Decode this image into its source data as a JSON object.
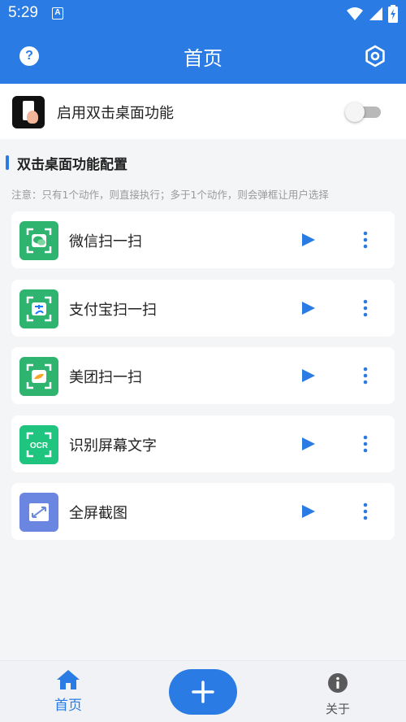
{
  "status_bar": {
    "time": "5:29",
    "notification_glyph": "A",
    "icons": [
      "wifi-icon",
      "signal-icon",
      "battery-icon"
    ]
  },
  "header": {
    "title": "首页",
    "left_icon": "help-icon",
    "right_icon": "settings-icon"
  },
  "feature_toggle": {
    "label": "启用双击桌面功能",
    "enabled": false
  },
  "section": {
    "title": "双击桌面功能配置",
    "note": "注意：只有1个动作，则直接执行；多于1个动作，则会弹框让用户选择"
  },
  "actions": [
    {
      "name": "微信扫一扫",
      "icon": "wechat-scan-icon"
    },
    {
      "name": "支付宝扫一扫",
      "icon": "alipay-scan-icon"
    },
    {
      "name": "美团扫一扫",
      "icon": "meituan-scan-icon"
    },
    {
      "name": "识别屏幕文字",
      "icon": "ocr-icon",
      "icon_text": "OCR"
    },
    {
      "name": "全屏截图",
      "icon": "fullscreen-screenshot-icon"
    }
  ],
  "bottom_nav": {
    "home_label": "首页",
    "about_label": "关于",
    "fab_icon": "plus-icon"
  },
  "colors": {
    "primary": "#2a7be4",
    "scan_green": "#2eb46f",
    "ocr_green": "#1fc47f",
    "screenshot_purple": "#6b86e0"
  }
}
